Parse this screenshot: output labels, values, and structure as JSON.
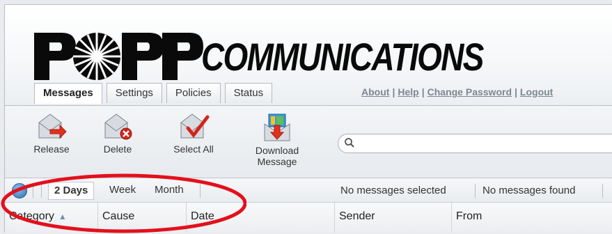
{
  "brand": {
    "logo_word": "COMMUNICATIONS",
    "logo_mark_letters": "POPP"
  },
  "tabs": [
    {
      "label": "Messages",
      "active": true
    },
    {
      "label": "Settings",
      "active": false
    },
    {
      "label": "Policies",
      "active": false
    },
    {
      "label": "Status",
      "active": false
    }
  ],
  "top_links": {
    "about": "About",
    "help": "Help",
    "change_password": "Change Password",
    "logout": "Logout",
    "separator": "|"
  },
  "toolbar": {
    "release": "Release",
    "delete": "Delete",
    "select_all": "Select All",
    "download_line1": "Download",
    "download_line2": "Message"
  },
  "search": {
    "value": "",
    "icon": "search-icon"
  },
  "filters": {
    "days": "2 Days",
    "week": "Week",
    "month": "Month",
    "selected_status": "No  messages selected",
    "found_status": "No messages found"
  },
  "table": {
    "columns": [
      "Category",
      "Cause",
      "Date",
      "Sender",
      "From"
    ],
    "sort_column": "Category",
    "sort_dir": "asc"
  },
  "colors": {
    "accent": "#2d6db3",
    "highlight_ring": "#e3101c",
    "link_grey": "#7d8692"
  }
}
